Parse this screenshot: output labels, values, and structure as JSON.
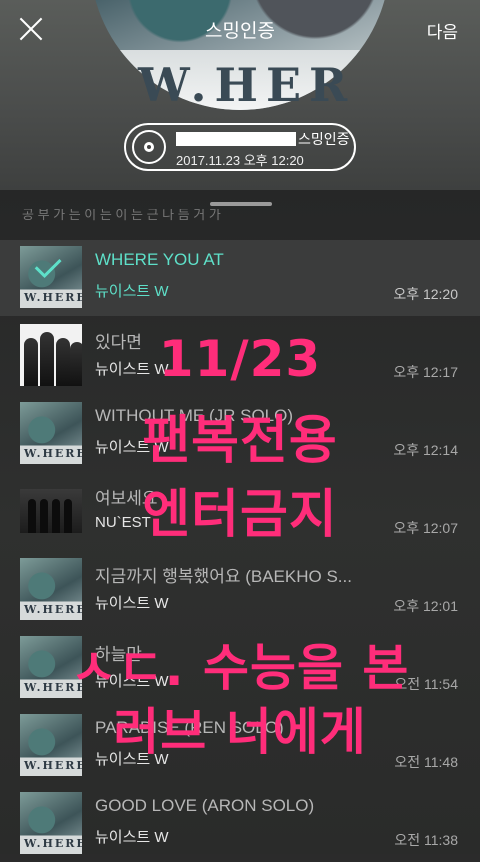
{
  "header": {
    "title": "스밍인증",
    "next_label": "다음",
    "cover_text": "W.HER"
  },
  "cert": {
    "suffix": "스밍인증",
    "datetime": "2017.11.23 오후 12:20"
  },
  "list": {
    "cut_text": "공 부 가 는 이 는 이 는 근 나 듬 거 가",
    "items": [
      {
        "title": "WHERE YOU AT",
        "artist": "뉴이스트 W",
        "time": "오후 12:20",
        "active": true
      },
      {
        "title": "있다면",
        "artist": "뉴이스트 W",
        "time": "오후 12:17"
      },
      {
        "title": "WITHOUT ME (JR SOLO)",
        "artist": "뉴이스트 W",
        "time": "오후 12:14"
      },
      {
        "title": "여보세요",
        "artist": "NU`EST",
        "time": "오후 12:07"
      },
      {
        "title": "지금까지 행복했어요 (BAEKHO S...",
        "artist": "뉴이스트 W",
        "time": "오후 12:01"
      },
      {
        "title": "하늘만",
        "artist": "뉴이스트 W",
        "time": "오전 11:54"
      },
      {
        "title": "PARADISE (REN SOLO)",
        "artist": "뉴이스트 W",
        "time": "오전 11:48"
      },
      {
        "title": "GOOD LOVE (ARON SOLO)",
        "artist": "뉴이스트 W",
        "time": "오전 11:38"
      }
    ]
  },
  "overlay": {
    "line1": "11/23",
    "line2": "팬복전용",
    "line3": "엔터금지",
    "line4": "ㅅㄷ. 수능을 본",
    "line5": "러브 너에게"
  },
  "colors": {
    "accent": "#5ee0c9",
    "overlay": "#ff2d7a"
  }
}
